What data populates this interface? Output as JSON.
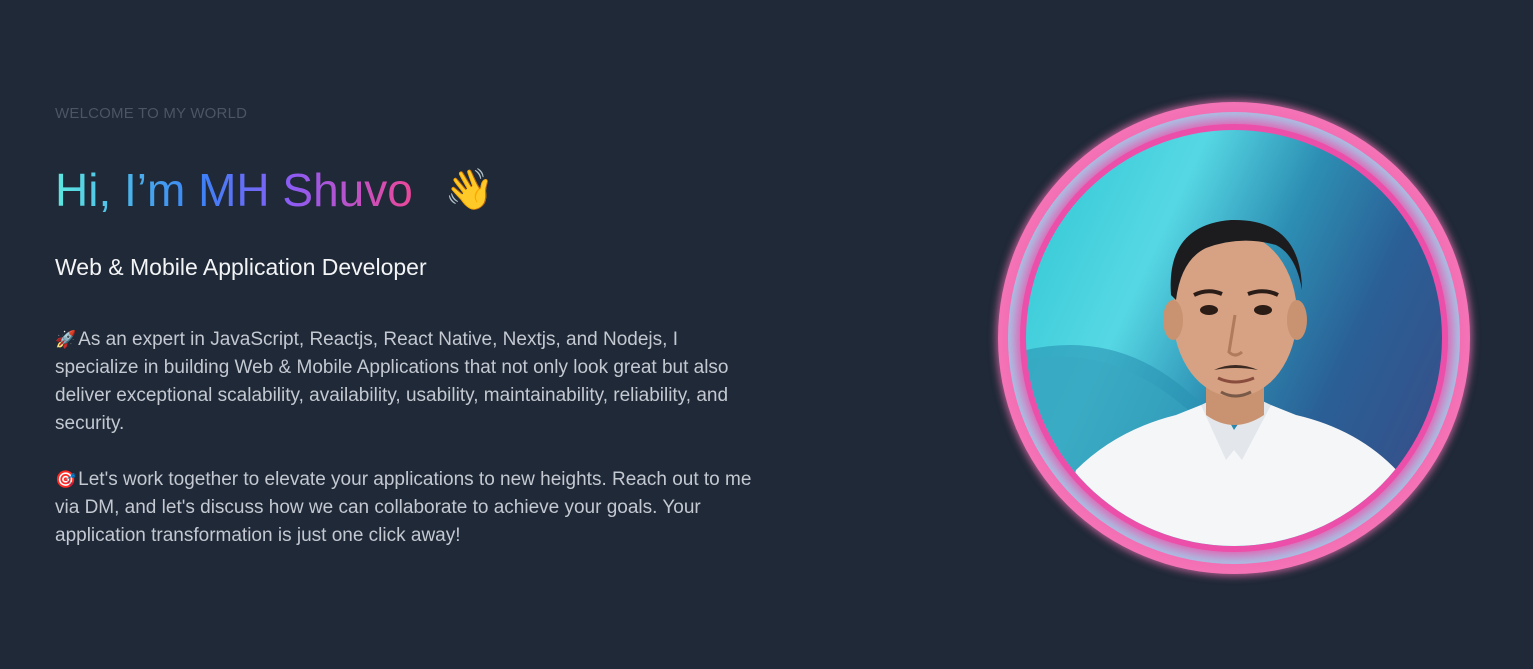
{
  "hero": {
    "eyebrow": "WELCOME TO MY WORLD",
    "headline": "Hi, I’m MH Shuvo",
    "wave_emoji": "👋",
    "role": "Web & Mobile Application Developer",
    "bio": [
      {
        "emoji": "🚀",
        "text": "As an expert in JavaScript, Reactjs, React Native, Nextjs, and Nodejs, I specialize in building Web & Mobile Applications that not only look great but also deliver exceptional scalability, availability, usability, maintainability, reliability, and security."
      },
      {
        "emoji": "🎯",
        "text": "Let's work together to elevate your applications to new heights. Reach out to me via DM, and let's discuss how we can collaborate to achieve your goals. Your application transformation is just one click away!"
      }
    ]
  },
  "colors": {
    "background": "#1f2937",
    "ring_pink": "#ec4fa9",
    "ring_light_blue": "#a7c4e6",
    "gradient_start": "#5ee7df",
    "gradient_end": "#ec4899"
  }
}
